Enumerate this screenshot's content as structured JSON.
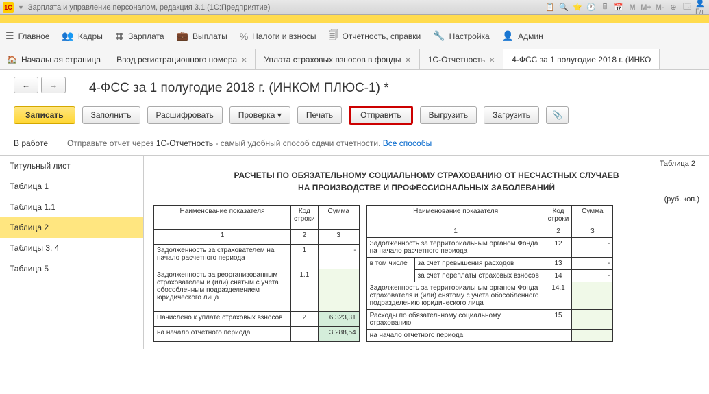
{
  "window": {
    "title": "Зарплата и управление персоналом, редакция 3.1  (1С:Предприятие)",
    "logo": "1С"
  },
  "title_icons": {
    "m": "M",
    "mplus": "M+",
    "mminus": "M-"
  },
  "menu": [
    {
      "icon": "☰",
      "label": "Главное"
    },
    {
      "icon": "👥",
      "label": "Кадры"
    },
    {
      "icon": "▦",
      "label": "Зарплата"
    },
    {
      "icon": "💼",
      "label": "Выплаты"
    },
    {
      "icon": "%",
      "label": "Налоги и взносы"
    },
    {
      "icon": "🗐",
      "label": "Отчетность, справки"
    },
    {
      "icon": "🔧",
      "label": "Настройка"
    },
    {
      "icon": "👤",
      "label": "Админ"
    }
  ],
  "tabs": [
    {
      "label": "Начальная страница",
      "home": true
    },
    {
      "label": "Ввод регистрационного номера"
    },
    {
      "label": "Уплата страховых взносов в фонды"
    },
    {
      "label": "1С-Отчетность"
    },
    {
      "label": "4-ФСС за 1 полугодие 2018 г. (ИНКО",
      "active": true
    }
  ],
  "page": {
    "title": "4-ФСС за 1 полугодие 2018 г. (ИНКОМ ПЛЮС-1) *"
  },
  "buttons": {
    "save": "Записать",
    "fill": "Заполнить",
    "decode": "Расшифровать",
    "check": "Проверка ▾",
    "print": "Печать",
    "send": "Отправить",
    "export": "Выгрузить",
    "import": "Загрузить",
    "clip": "📎"
  },
  "info": {
    "status": "В работе",
    "text1": "Отправьте отчет через ",
    "link1": "1С-Отчетность",
    "text2": " - самый удобный способ сдачи отчетности. ",
    "link2": "Все способы"
  },
  "sidebar": [
    "Титульный лист",
    "Таблица 1",
    "Таблица 1.1",
    "Таблица 2",
    "Таблицы 3, 4",
    "Таблица 5"
  ],
  "sidebar_active": 3,
  "report": {
    "table_label": "Таблица 2",
    "title1": "РАСЧЕТЫ ПО ОБЯЗАТЕЛЬНОМУ СОЦИАЛЬНОМУ СТРАХОВАНИЮ ОТ НЕСЧАСТНЫХ СЛУЧАЕВ",
    "title2": "НА ПРОИЗВОДСТВЕ И ПРОФЕССИОНАЛЬНЫХ ЗАБОЛЕВАНИЙ",
    "unit": "(руб. коп.)",
    "headers": {
      "name": "Наименование показателя",
      "code": "Код строки",
      "sum": "Сумма"
    },
    "colnums": {
      "c1": "1",
      "c2": "2",
      "c3": "3"
    },
    "left": [
      {
        "name": "Задолженность за страхователем на начало расчетного периода",
        "code": "1",
        "sum": "-"
      },
      {
        "name": "Задолженность за реорганизованным страхователем и (или) снятым с учета обособленным подразделением юридического лица",
        "code": "1.1",
        "sum": ""
      },
      {
        "name": "Начислено к уплате страховых взносов",
        "code": "2",
        "sum": "6 323,31"
      },
      {
        "name": "на начало отчетного периода",
        "code": "",
        "sum": "3 288,54"
      }
    ],
    "right": [
      {
        "name": "Задолженность за территориальным органом Фонда на начало расчетного периода",
        "code": "12",
        "sum": "-"
      },
      {
        "name": "в том числе",
        "sub": "за счет превышения расходов",
        "code": "13",
        "sum": "-"
      },
      {
        "name": "",
        "sub": "за счет переплаты страховых взносов",
        "code": "14",
        "sum": "-"
      },
      {
        "name": "Задолженность за территориальным органом Фонда страхователя и (или) снятому с учета обособленного подразделению юридического лица",
        "code": "14.1",
        "sum": ""
      },
      {
        "name": "Расходы по обязательному социальному страхованию",
        "code": "15",
        "sum": ""
      },
      {
        "name": "на начало отчетного периода",
        "code": "",
        "sum": ""
      }
    ]
  }
}
